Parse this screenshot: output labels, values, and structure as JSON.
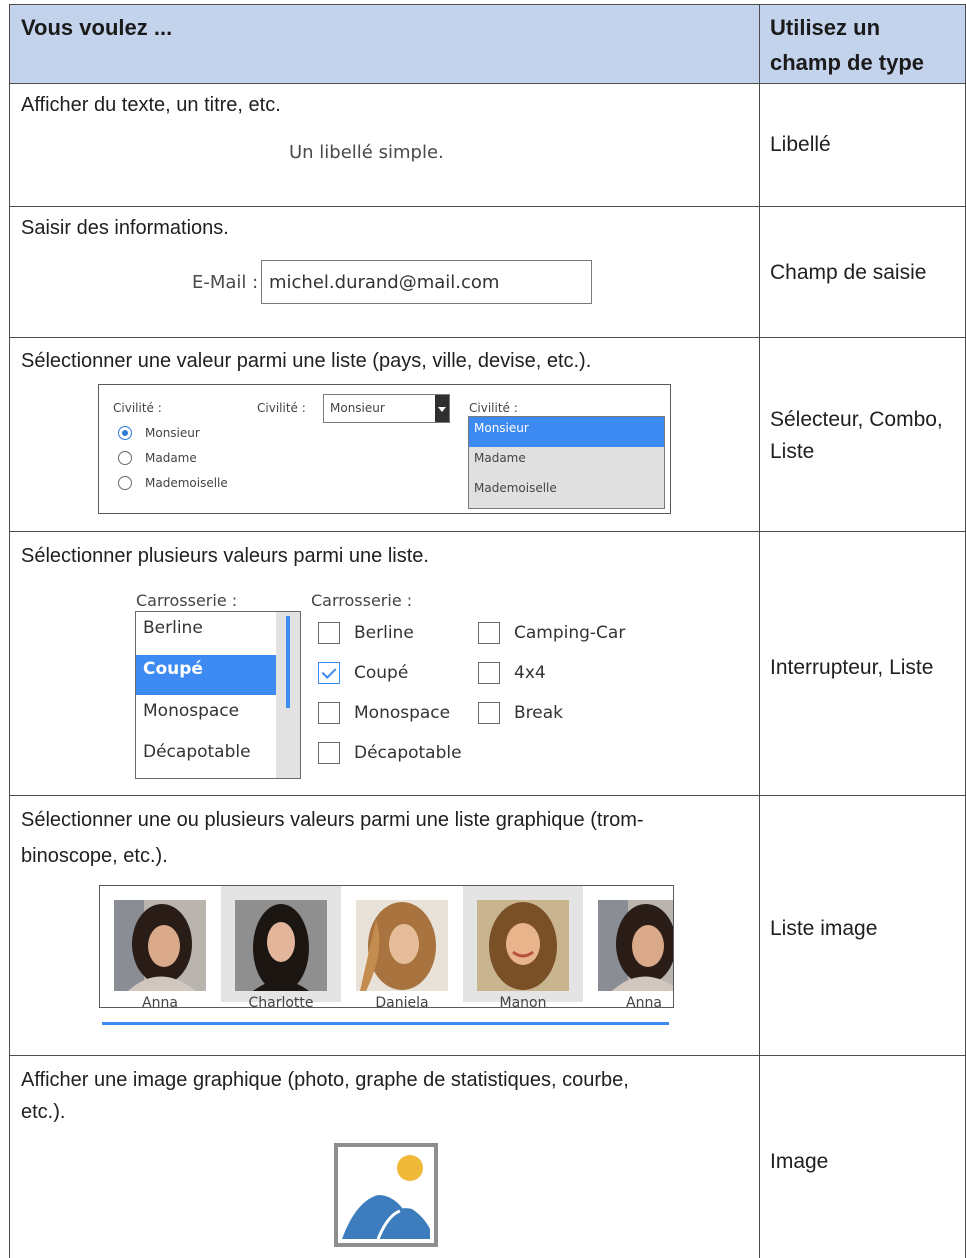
{
  "header": {
    "col1": "Vous voulez ...",
    "col2_line1": "Utilisez un",
    "col2_line2": "champ de type"
  },
  "rows": [
    {
      "desc": "Afficher du texte, un titre, etc.",
      "type": "Libellé",
      "example": {
        "label": "Un libellé simple."
      }
    },
    {
      "desc": "Saisir des informations.",
      "type": "Champ de saisie",
      "example": {
        "label": "E-Mail :",
        "value": "michel.durand@mail.com"
      }
    },
    {
      "desc": "Sélectionner une valeur parmi une liste (pays, ville, devise, etc.).",
      "type_line1": "Sélecteur, Combo,",
      "type_line2": "Liste",
      "example": {
        "radio_label": "Civilité :",
        "radio_options": [
          "Monsieur",
          "Madame",
          "Mademoiselle"
        ],
        "radio_selected": "Monsieur",
        "combo_label": "Civilité :",
        "combo_value": "Monsieur",
        "list_label": "Civilité :",
        "list_options": [
          "Monsieur",
          "Madame",
          "Mademoiselle"
        ],
        "list_selected": "Monsieur"
      }
    },
    {
      "desc": "Sélectionner plusieurs valeurs parmi une liste.",
      "type": "Interrupteur, Liste",
      "example": {
        "list_label": "Carrosserie :",
        "list_options": [
          "Berline",
          "Coupé",
          "Monospace",
          "Décapotable"
        ],
        "list_selected": "Coupé",
        "check_label": "Carrosserie :",
        "check_col1": [
          "Berline",
          "Coupé",
          "Monospace",
          "Décapotable"
        ],
        "check_col2": [
          "Camping-Car",
          "4x4",
          "Break"
        ],
        "checked": [
          "Coupé"
        ]
      }
    },
    {
      "desc_line1": "Sélectionner une ou plusieurs valeurs parmi une liste graphique (trom-",
      "desc_line2": "binoscope, etc.).",
      "type": "Liste image",
      "example": {
        "names": [
          "Anna",
          "Charlotte",
          "Daniela",
          "Manon",
          "Anna"
        ]
      }
    },
    {
      "desc_line1": "Afficher une image graphique (photo, graphe de statistiques, courbe,",
      "desc_line2": "etc.).",
      "type": "Image",
      "example": {
        "icon": "image-placeholder-icon"
      }
    }
  ],
  "colors": {
    "header_bg": "#c4d3ec",
    "selection_blue": "#3d8af3",
    "border": "#4d4d4d",
    "image_icon_sun": "#f0b93a",
    "image_icon_mountain": "#3d7dbd"
  }
}
